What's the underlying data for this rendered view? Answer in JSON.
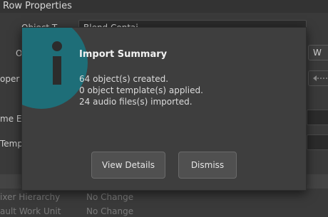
{
  "background": {
    "panel_title": "Row Properties",
    "fields": [
      {
        "label": "Object T",
        "value": "Blend Contai"
      },
      {
        "label": "O",
        "value": ""
      },
      {
        "label": "oper",
        "value": ""
      },
      {
        "label": "me Ex",
        "value": ""
      },
      {
        "label": "Temp",
        "value": ""
      }
    ],
    "side_button_label": "W",
    "bottom_rows": [
      {
        "label": "ixer Hierarchy",
        "value": "No Change"
      },
      {
        "label": "ault Work Unit",
        "value": "No Change"
      }
    ]
  },
  "dialog": {
    "title": "Import Summary",
    "lines": [
      "64 object(s) created.",
      "0 object template(s) applied.",
      "24 audio files(s) imported."
    ],
    "buttons": {
      "view_details": "View Details",
      "dismiss": "Dismiss"
    },
    "icon": "info-icon",
    "accent_color": "#1e6e78"
  }
}
